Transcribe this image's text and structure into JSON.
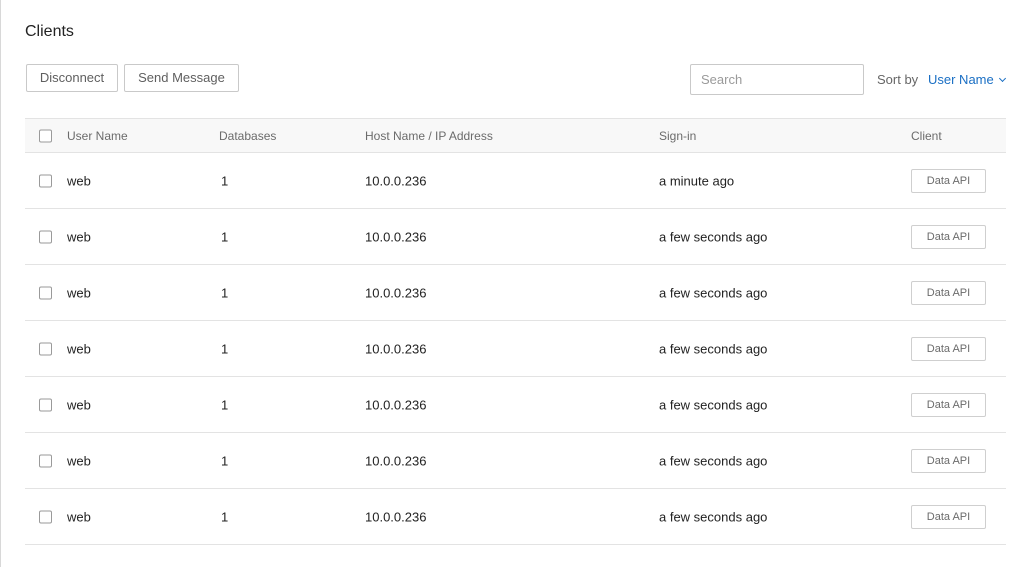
{
  "page": {
    "title": "Clients"
  },
  "toolbar": {
    "disconnect_label": "Disconnect",
    "send_message_label": "Send Message",
    "search_placeholder": "Search",
    "sort_label": "Sort by",
    "sort_value": "User Name"
  },
  "table": {
    "columns": {
      "user_name": "User Name",
      "databases": "Databases",
      "host": "Host Name / IP Address",
      "sign_in": "Sign-in",
      "client": "Client"
    },
    "rows": [
      {
        "user": "web",
        "databases": "1",
        "host": "10.0.0.236",
        "sign_in": "a minute ago",
        "client": "Data API"
      },
      {
        "user": "web",
        "databases": "1",
        "host": "10.0.0.236",
        "sign_in": "a few seconds ago",
        "client": "Data API"
      },
      {
        "user": "web",
        "databases": "1",
        "host": "10.0.0.236",
        "sign_in": "a few seconds ago",
        "client": "Data API"
      },
      {
        "user": "web",
        "databases": "1",
        "host": "10.0.0.236",
        "sign_in": "a few seconds ago",
        "client": "Data API"
      },
      {
        "user": "web",
        "databases": "1",
        "host": "10.0.0.236",
        "sign_in": "a few seconds ago",
        "client": "Data API"
      },
      {
        "user": "web",
        "databases": "1",
        "host": "10.0.0.236",
        "sign_in": "a few seconds ago",
        "client": "Data API"
      },
      {
        "user": "web",
        "databases": "1",
        "host": "10.0.0.236",
        "sign_in": "a few seconds ago",
        "client": "Data API"
      }
    ]
  },
  "colors": {
    "accent": "#1a6fc4",
    "border": "#e3e3e3",
    "header_bg": "#f8f8f8"
  },
  "icons": {
    "sort": "chevron-down-icon"
  }
}
